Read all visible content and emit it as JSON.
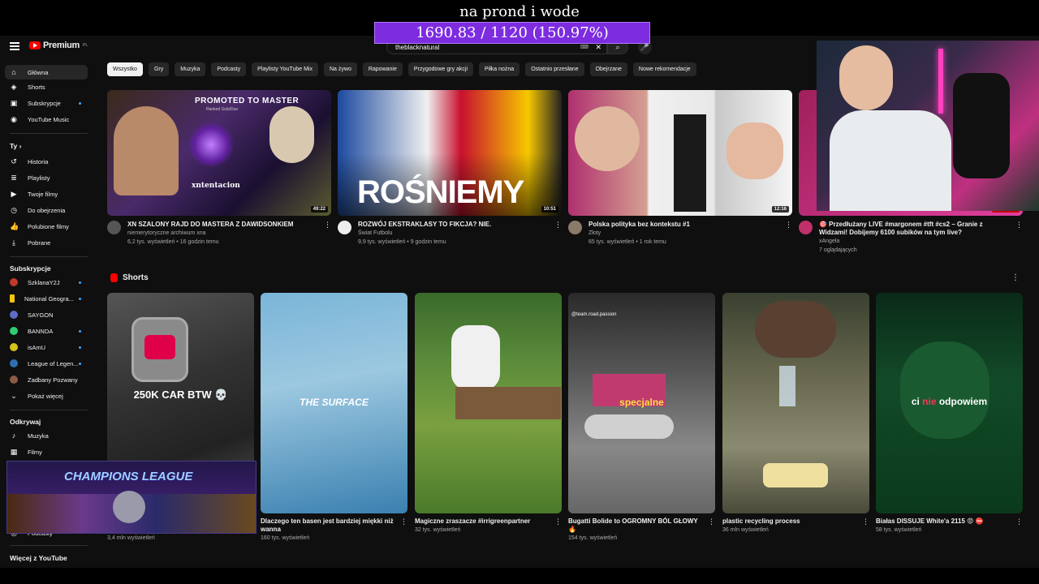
{
  "overlay": {
    "title": "na prond i wode",
    "goal": "1690.83 / 1120 (150.97%)",
    "goal_fraction": 1.5097
  },
  "header": {
    "logo_text": "Premium",
    "logo_sup": "PL",
    "search_value": "theblacknatural"
  },
  "sidebar": {
    "main": [
      "Główna",
      "Shorts",
      "Subskrypcje",
      "YouTube Music"
    ],
    "you_label": "Ty",
    "you": [
      "Historia",
      "Playlisty",
      "Twoje filmy",
      "Do obejrzenia",
      "Polubione filmy",
      "Pobrane"
    ],
    "subs_label": "Subskrypcje",
    "subs": [
      "SzklanaY2J",
      "National Geogra...",
      "SAYGON",
      "BANNDA",
      "isAmU",
      "League of Legen...",
      "Zadbany Pozwany",
      "Pokaż więcej"
    ],
    "explore_label": "Odkrywaj",
    "explore": [
      "Muzyka",
      "Filmy",
      "Podcasty"
    ],
    "more_label": "Więcej z YouTube"
  },
  "chips": [
    "Wszystko",
    "Gry",
    "Muzyka",
    "Podcasty",
    "Playlisty YouTube Mix",
    "Na żywo",
    "Rapowanie",
    "Przygodowe gry akcji",
    "Piłka nożna",
    "Ostatnio przesłane",
    "Obejrzane",
    "Nowe rekomendacje"
  ],
  "videos": [
    {
      "title": "XN SZALONY RAJD DO MASTERA Z DAWIDSONKIEM",
      "channel": "niemerytoryczne archiwum xna",
      "stats": "6,2 tys. wyświetleń • 16 godzin temu",
      "duration": "49:22",
      "thumb_text": "PROMOTED TO MASTER",
      "thumb_sub": "Ranked Solo/Duo",
      "thumb_name": "xntentacion"
    },
    {
      "title": "ROZWÓJ EKSTRAKLASY TO FIKCJA? NIE.",
      "channel": "Świat Futbolu",
      "stats": "9,9 tys. wyświetleń • 9 godzin temu",
      "duration": "10:51",
      "thumb_text": "ROŚNIEMY"
    },
    {
      "title": "Polska polityka bez kontekstu  #1",
      "channel": "Złoty",
      "stats": "65 tys. wyświetleń • 1 rok temu",
      "duration": "12:16"
    },
    {
      "title": "🎯 Przedłużany LIVE #margonem #tft #cs2  – Granie z Widzami! Dobijemy 6100 subików na tym live?",
      "channel": "xAngela",
      "stats": "7 oglądających",
      "live": "NA ŻYWO"
    }
  ],
  "shorts": {
    "label": "Shorts",
    "items": [
      {
        "title": "",
        "views": "3,4 mln wyświetleń",
        "caption": "250K CAR BTW 💀"
      },
      {
        "title": "Dlaczego ten basen jest bardziej miękki niż wanna",
        "views": "160 tys. wyświetleń",
        "caption": "THE SURFACE"
      },
      {
        "title": "Magiczne zraszacze #irrigreenpartner",
        "views": "32 tys. wyświetleń",
        "caption": ""
      },
      {
        "title": "Bugatti Bolide to OGROMNY BÓL GŁOWY🔥",
        "views": "154 tys. wyświetleń",
        "caption": "specjalne",
        "handle": "@team.road.passion"
      },
      {
        "title": "plastic recycling process",
        "views": "36 mln wyświetleń",
        "caption": ""
      },
      {
        "title": "Białas DISSUJE White'a 2115 😡 ⛔",
        "views": "58 tys. wyświetleń",
        "caption_a": "ci ",
        "caption_b": "nie",
        "caption_c": " odpowiem"
      }
    ]
  },
  "overlay_box": {
    "title": "CHAMPIONS LEAGUE"
  },
  "colors": {
    "accent": "#ff0000",
    "goal": "#7d2ce0",
    "bg": "#0f0f0f"
  }
}
